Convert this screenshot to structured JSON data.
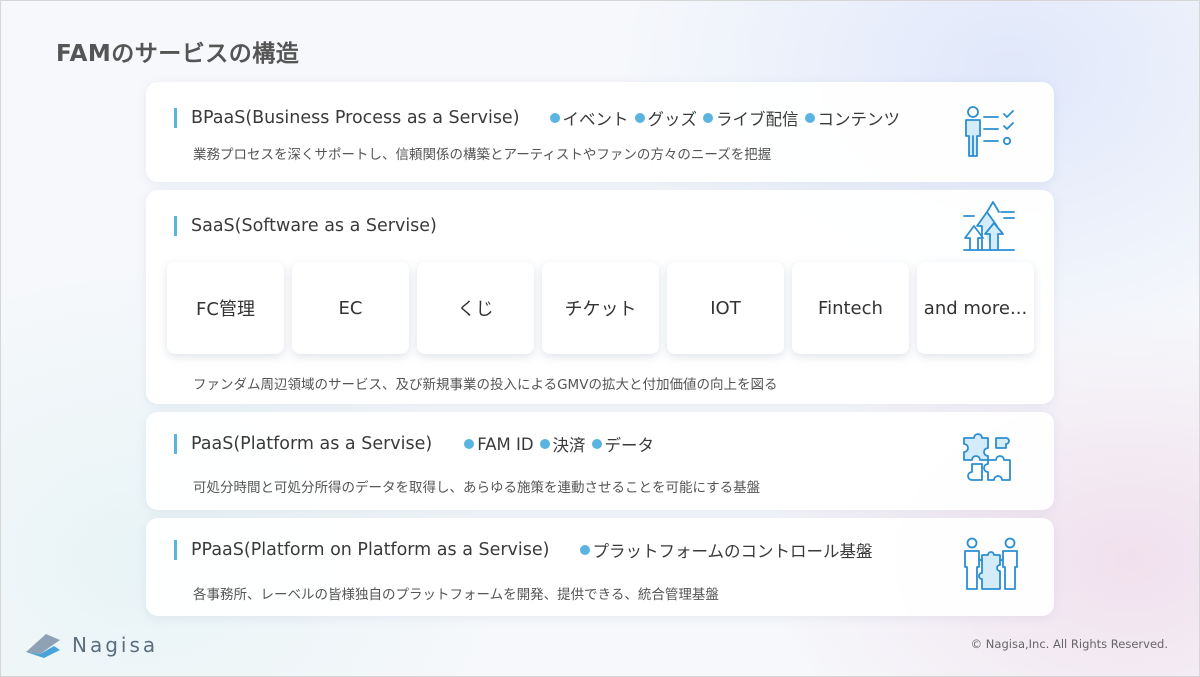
{
  "page": {
    "title": "FAMのサービスの構造"
  },
  "layers": [
    {
      "name": "BPaaS(Business Process as a Servise)",
      "tags": [
        "イベント",
        "グッズ",
        "ライブ配信",
        "コンテンツ"
      ],
      "description": "業務プロセスを深くサポートし、信頼関係の構築とアーティストやファンの方々のニーズを把握",
      "icon": "team-checklist-icon"
    },
    {
      "name": "SaaS(Software as a Servise)",
      "tiles": [
        "FC管理",
        "EC",
        "くじ",
        "チケット",
        "IOT",
        "Fintech",
        "and more..."
      ],
      "description": "ファンダム周辺領域のサービス、及び新規事業の投入によるGMVの拡大と付加価値の向上を図る",
      "icon": "growth-arrows-icon"
    },
    {
      "name": "PaaS(Platform as a Servise)",
      "tags": [
        "FAM ID",
        "決済",
        "データ"
      ],
      "description": "可処分時間と可処分所得のデータを取得し、あらゆる施策を連動させることを可能にする基盤",
      "icon": "puzzle-icon"
    },
    {
      "name": "PPaaS(Platform on Platform as a Servise)",
      "tags": [
        "プラットフォームのコントロール基盤"
      ],
      "description": "各事務所、レーベルの皆様独自のプラットフォームを開発、提供できる、統合管理基盤",
      "icon": "partners-puzzle-icon"
    }
  ],
  "footer": {
    "brand": "Nagisa",
    "copyright": "© Nagisa,Inc. All Rights Reserved."
  },
  "colors": {
    "accent": "#5ab4e0",
    "title": "#555555",
    "text": "#3a3a3a"
  }
}
